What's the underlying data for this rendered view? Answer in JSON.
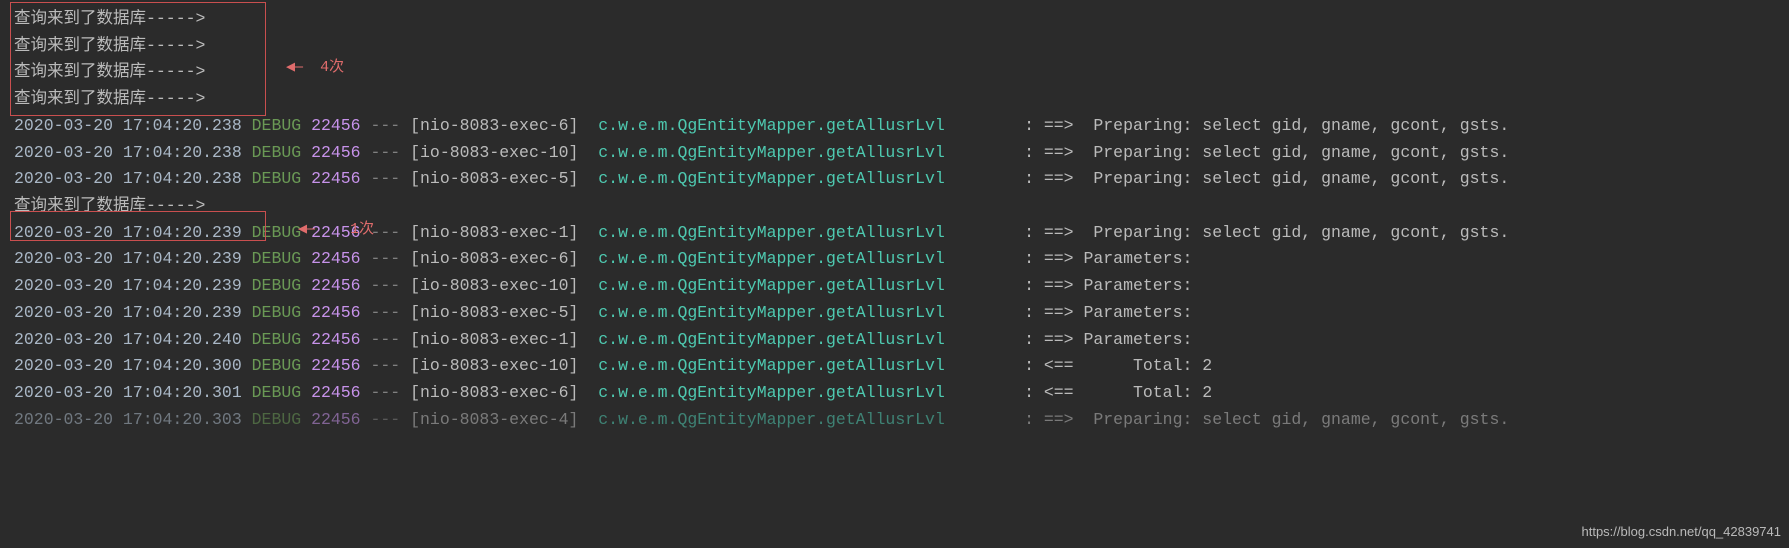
{
  "db_msg": "查询来到了数据库----->",
  "annotations": {
    "a1": {
      "arrow": "◀—",
      "label": "4次"
    },
    "a2": {
      "arrow": "◀—",
      "label": "1次"
    }
  },
  "watermark": "https://blog.csdn.net/qq_42839741",
  "rows": [
    {
      "ts": "2020-03-20 17:04:20.238",
      "lvl": "DEBUG",
      "pid": "22456",
      "sep": "---",
      "thr": "[nio-8083-exec-6]",
      "logger": "c.w.e.m.QgEntityMapper.getAllusrLvl",
      "msg": ": ==>  Preparing: select gid, gname, gcont, gsts."
    },
    {
      "ts": "2020-03-20 17:04:20.238",
      "lvl": "DEBUG",
      "pid": "22456",
      "sep": "---",
      "thr": "[io-8083-exec-10]",
      "logger": "c.w.e.m.QgEntityMapper.getAllusrLvl",
      "msg": ": ==>  Preparing: select gid, gname, gcont, gsts."
    },
    {
      "ts": "2020-03-20 17:04:20.238",
      "lvl": "DEBUG",
      "pid": "22456",
      "sep": "---",
      "thr": "[nio-8083-exec-5]",
      "logger": "c.w.e.m.QgEntityMapper.getAllusrLvl",
      "msg": ": ==>  Preparing: select gid, gname, gcont, gsts."
    },
    {
      "db": true
    },
    {
      "ts": "2020-03-20 17:04:20.239",
      "lvl": "DEBUG",
      "pid": "22456",
      "sep": "---",
      "thr": "[nio-8083-exec-1]",
      "logger": "c.w.e.m.QgEntityMapper.getAllusrLvl",
      "msg": ": ==>  Preparing: select gid, gname, gcont, gsts."
    },
    {
      "ts": "2020-03-20 17:04:20.239",
      "lvl": "DEBUG",
      "pid": "22456",
      "sep": "---",
      "thr": "[nio-8083-exec-6]",
      "logger": "c.w.e.m.QgEntityMapper.getAllusrLvl",
      "msg": ": ==> Parameters: "
    },
    {
      "ts": "2020-03-20 17:04:20.239",
      "lvl": "DEBUG",
      "pid": "22456",
      "sep": "---",
      "thr": "[io-8083-exec-10]",
      "logger": "c.w.e.m.QgEntityMapper.getAllusrLvl",
      "msg": ": ==> Parameters: "
    },
    {
      "ts": "2020-03-20 17:04:20.239",
      "lvl": "DEBUG",
      "pid": "22456",
      "sep": "---",
      "thr": "[nio-8083-exec-5]",
      "logger": "c.w.e.m.QgEntityMapper.getAllusrLvl",
      "msg": ": ==> Parameters: "
    },
    {
      "ts": "2020-03-20 17:04:20.240",
      "lvl": "DEBUG",
      "pid": "22456",
      "sep": "---",
      "thr": "[nio-8083-exec-1]",
      "logger": "c.w.e.m.QgEntityMapper.getAllusrLvl",
      "msg": ": ==> Parameters: "
    },
    {
      "ts": "2020-03-20 17:04:20.300",
      "lvl": "DEBUG",
      "pid": "22456",
      "sep": "---",
      "thr": "[io-8083-exec-10]",
      "logger": "c.w.e.m.QgEntityMapper.getAllusrLvl",
      "msg": ": <==      Total: 2"
    },
    {
      "ts": "2020-03-20 17:04:20.301",
      "lvl": "DEBUG",
      "pid": "22456",
      "sep": "---",
      "thr": "[nio-8083-exec-6]",
      "logger": "c.w.e.m.QgEntityMapper.getAllusrLvl",
      "msg": ": <==      Total: 2"
    },
    {
      "ts": "2020-03-20 17:04:20.303",
      "lvl": "DEBUG",
      "pid": "22456",
      "sep": "---",
      "thr": "[nio-8083-exec-4]",
      "logger": "c.w.e.m.QgEntityMapper.getAllusrLvl",
      "msg": ": ==>  Preparing: select gid, gname, gcont, gsts.",
      "faded": true
    }
  ]
}
